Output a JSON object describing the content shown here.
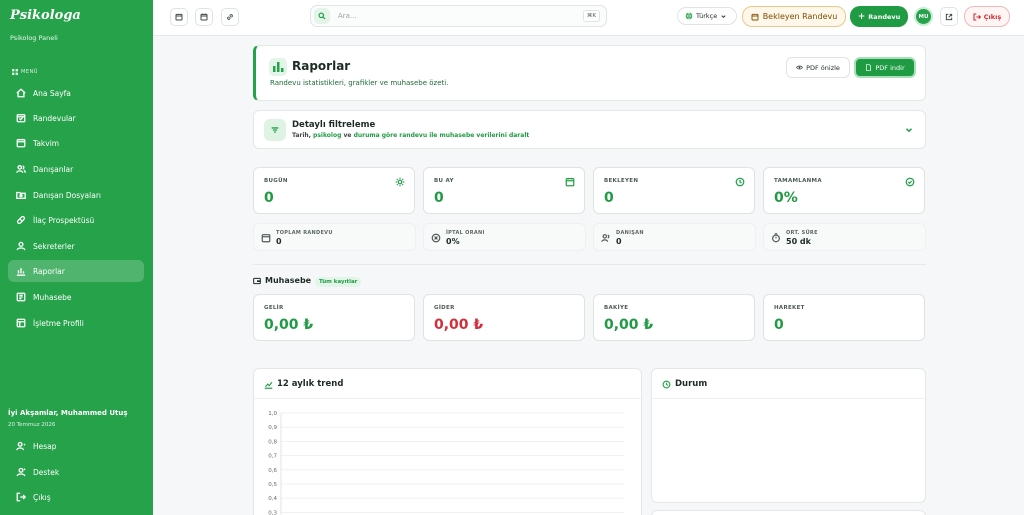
{
  "sidebar": {
    "brand": "Psikologa",
    "brand_sub": "Psikolog Paneli",
    "menu_label": "MENÜ",
    "items": [
      {
        "label": "Ana Sayfa",
        "icon": "home-icon"
      },
      {
        "label": "Randevular",
        "icon": "calendar-check-icon"
      },
      {
        "label": "Takvim",
        "icon": "calendar-icon"
      },
      {
        "label": "Danışanlar",
        "icon": "users-icon"
      },
      {
        "label": "Danışan Dosyaları",
        "icon": "folder-icon"
      },
      {
        "label": "İlaç Prospektüsü",
        "icon": "pill-icon"
      },
      {
        "label": "Sekreterler",
        "icon": "user-icon"
      },
      {
        "label": "Raporlar",
        "icon": "bar-chart-icon",
        "active": true
      },
      {
        "label": "Muhasebe",
        "icon": "ledger-icon"
      },
      {
        "label": "İşletme Profili",
        "icon": "building-icon"
      }
    ],
    "greeting": "İyi Akşamlar, Muhammed Utuş",
    "date": "20 Temmuz 2026",
    "bottom_items": [
      {
        "label": "Hesap",
        "icon": "account-icon"
      },
      {
        "label": "Destek",
        "icon": "support-icon"
      },
      {
        "label": "Çıkış",
        "icon": "logout-icon"
      }
    ]
  },
  "topbar": {
    "search_placeholder": "Ara...",
    "search_shortcut": "⌘K",
    "language": "Türkçe",
    "pending_label": "Bekleyen Randevu",
    "new_appointment_label": "Randevu",
    "avatar_initials": "MU",
    "logout_label": "Çıkış"
  },
  "header": {
    "title": "Raporlar",
    "subtitle": "Randevu istatistikleri, grafikler ve muhasebe özeti.",
    "preview_label": "PDF önizle",
    "download_label": "PDF indir"
  },
  "filter": {
    "title": "Detaylı filtreleme",
    "sub_prefix": "Tarih, ",
    "sub_g1": "psikolog",
    "sub_mid": " ve ",
    "sub_g2": "duruma göre randevu ile muhasebe verilerini daralt"
  },
  "stats": [
    {
      "label": "BUGÜN",
      "value": "0",
      "icon": "sun-icon"
    },
    {
      "label": "BU AY",
      "value": "0",
      "icon": "calendar-icon"
    },
    {
      "label": "BEKLEYEN",
      "value": "0",
      "icon": "clock-icon"
    },
    {
      "label": "TAMAMLANMA",
      "value": "0%",
      "icon": "check-circle-icon"
    }
  ],
  "mini_stats": [
    {
      "label": "TOPLAM RANDEVU",
      "value": "0",
      "icon": "calendar-icon"
    },
    {
      "label": "İPTAL ORANI",
      "value": "0%",
      "icon": "x-circle-icon"
    },
    {
      "label": "DANIŞAN",
      "value": "0",
      "icon": "users-icon"
    },
    {
      "label": "ORT. SÜRE",
      "value": "50 dk",
      "icon": "timer-icon"
    }
  ],
  "accounting": {
    "title": "Muhasebe",
    "badge": "Tüm kayıtlar",
    "cards": [
      {
        "label": "GELİR",
        "value": "0,00 ₺",
        "color": "#1f9b43"
      },
      {
        "label": "GİDER",
        "value": "0,00 ₺",
        "color": "#d22f3a"
      },
      {
        "label": "BAKİYE",
        "value": "0,00 ₺",
        "color": "#1f9b43"
      },
      {
        "label": "HAREKET",
        "value": "0",
        "color": "#1f9b43"
      }
    ]
  },
  "trend": {
    "title": "12 aylık trend"
  },
  "status_panel": {
    "title": "Durum"
  },
  "chart_data": {
    "type": "line",
    "title": "12 aylık trend",
    "ylim": [
      0,
      1
    ],
    "y_ticks": [
      "1,0",
      "0,9",
      "0,8",
      "0,7",
      "0,6",
      "0,5",
      "0,4",
      "0,3"
    ],
    "grid": true,
    "series": []
  },
  "colors": {
    "brand": "#25a24a",
    "accent_dark": "#1f9b43",
    "danger": "#d22f3a"
  }
}
